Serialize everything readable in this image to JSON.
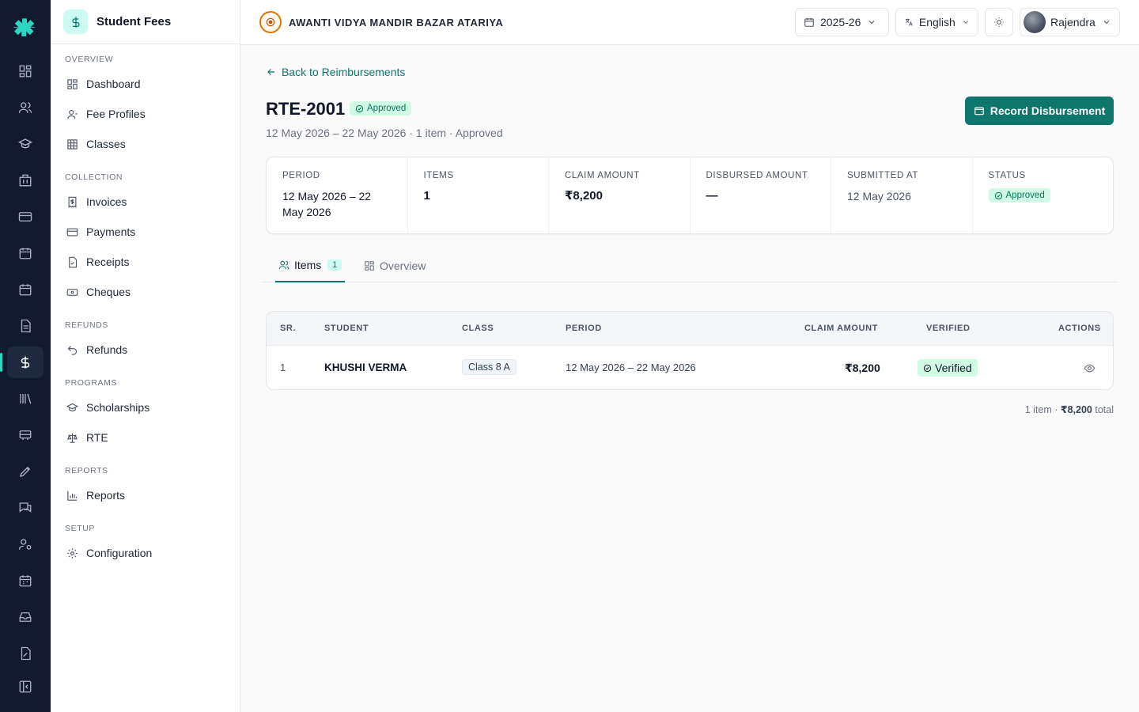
{
  "sidebar": {
    "title": "Student Fees",
    "sections": {
      "overview": "OVERVIEW",
      "collection": "COLLECTION",
      "refunds": "REFUNDS",
      "programs": "PROGRAMS",
      "reports": "REPORTS",
      "setup": "SETUP"
    },
    "items": {
      "dashboard": "Dashboard",
      "fee_profiles": "Fee Profiles",
      "classes": "Classes",
      "invoices": "Invoices",
      "payments": "Payments",
      "receipts": "Receipts",
      "cheques": "Cheques",
      "refunds": "Refunds",
      "scholarships": "Scholarships",
      "rte": "RTE",
      "reports": "Reports",
      "configuration": "Configuration"
    }
  },
  "topbar": {
    "school_name": "AWANTI VIDYA MANDIR BAZAR ATARIYA",
    "year": "2025-26",
    "language": "English",
    "user": "Rajendra"
  },
  "page": {
    "back_link": "Back to Reimbursements",
    "title": "RTE-2001",
    "status": "Approved",
    "subtitle": "12 May 2026 – 22 May 2026 · 1 item · Approved",
    "primary_action": "Record Disbursement"
  },
  "stats": [
    {
      "label": "PERIOD",
      "value": "12 May 2026 – 22 May 2026"
    },
    {
      "label": "ITEMS",
      "value": "1"
    },
    {
      "label": "CLAIM AMOUNT",
      "value": "₹8,200"
    },
    {
      "label": "DISBURSED AMOUNT",
      "value": "—"
    },
    {
      "label": "SUBMITTED AT",
      "value": "12 May 2026"
    },
    {
      "label": "STATUS",
      "value": "Approved"
    }
  ],
  "tabs": {
    "items": "Items",
    "items_count": "1",
    "overview": "Overview"
  },
  "table": {
    "headers": {
      "sr": "SR.",
      "student": "STUDENT",
      "class": "CLASS",
      "period": "PERIOD",
      "claim_amount": "CLAIM AMOUNT",
      "verified": "VERIFIED",
      "actions": "ACTIONS"
    },
    "rows": [
      {
        "sr": "1",
        "student": "KHUSHI VERMA",
        "class": "Class 8 A",
        "period": "12 May 2026 – 22 May 2026",
        "claim_amount": "₹8,200",
        "verified": "Verified"
      }
    ]
  },
  "footer": {
    "count": "1 item · ",
    "total": "₹8,200",
    "suffix": " total"
  },
  "colors": {
    "accent": "#0f766e",
    "rail": "#111a2e",
    "success_bg": "#d1fae5",
    "success_text": "#047857"
  }
}
